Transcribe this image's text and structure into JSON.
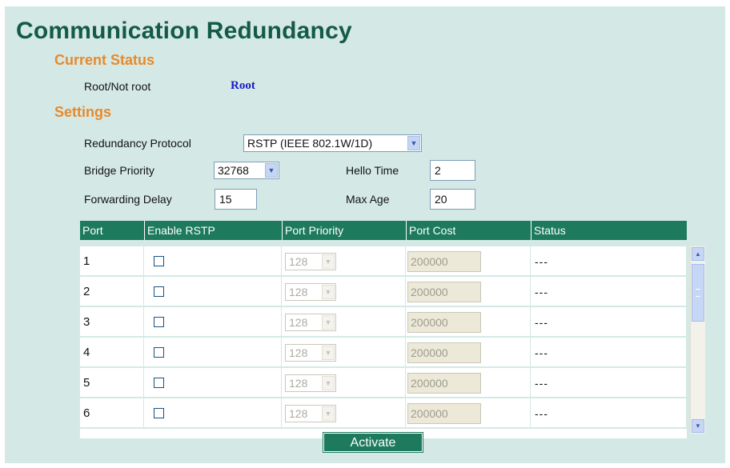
{
  "page_title": "Communication Redundancy",
  "current_status": {
    "heading": "Current Status",
    "root_label": "Root/Not root",
    "root_value": "Root"
  },
  "settings": {
    "heading": "Settings",
    "redundancy_protocol": {
      "label": "Redundancy Protocol",
      "value": "RSTP (IEEE 802.1W/1D)"
    },
    "bridge_priority": {
      "label": "Bridge Priority",
      "value": "32768"
    },
    "hello_time": {
      "label": "Hello Time",
      "value": "2"
    },
    "forwarding_delay": {
      "label": "Forwarding Delay",
      "value": "15"
    },
    "max_age": {
      "label": "Max Age",
      "value": "20"
    }
  },
  "table": {
    "headers": [
      "Port",
      "Enable RSTP",
      "Port Priority",
      "Port Cost",
      "Status"
    ],
    "rows": [
      {
        "port": "1",
        "enable_rstp": false,
        "priority": "128",
        "cost": "200000",
        "status": "---"
      },
      {
        "port": "2",
        "enable_rstp": false,
        "priority": "128",
        "cost": "200000",
        "status": "---"
      },
      {
        "port": "3",
        "enable_rstp": false,
        "priority": "128",
        "cost": "200000",
        "status": "---"
      },
      {
        "port": "4",
        "enable_rstp": false,
        "priority": "128",
        "cost": "200000",
        "status": "---"
      },
      {
        "port": "5",
        "enable_rstp": false,
        "priority": "128",
        "cost": "200000",
        "status": "---"
      },
      {
        "port": "6",
        "enable_rstp": false,
        "priority": "128",
        "cost": "200000",
        "status": "---"
      }
    ]
  },
  "icons": {
    "dropdown": "chevron-down-icon",
    "scroll_up": "scroll-up-arrow-icon",
    "scroll_down": "scroll-down-arrow-icon"
  },
  "colors": {
    "panel_bg": "#d4e9e5",
    "title": "#145a47",
    "section_heading": "#e8892b",
    "root_value": "#1a1ac8",
    "table_header_bg": "#1d7a5c"
  },
  "activate_label": "Activate"
}
